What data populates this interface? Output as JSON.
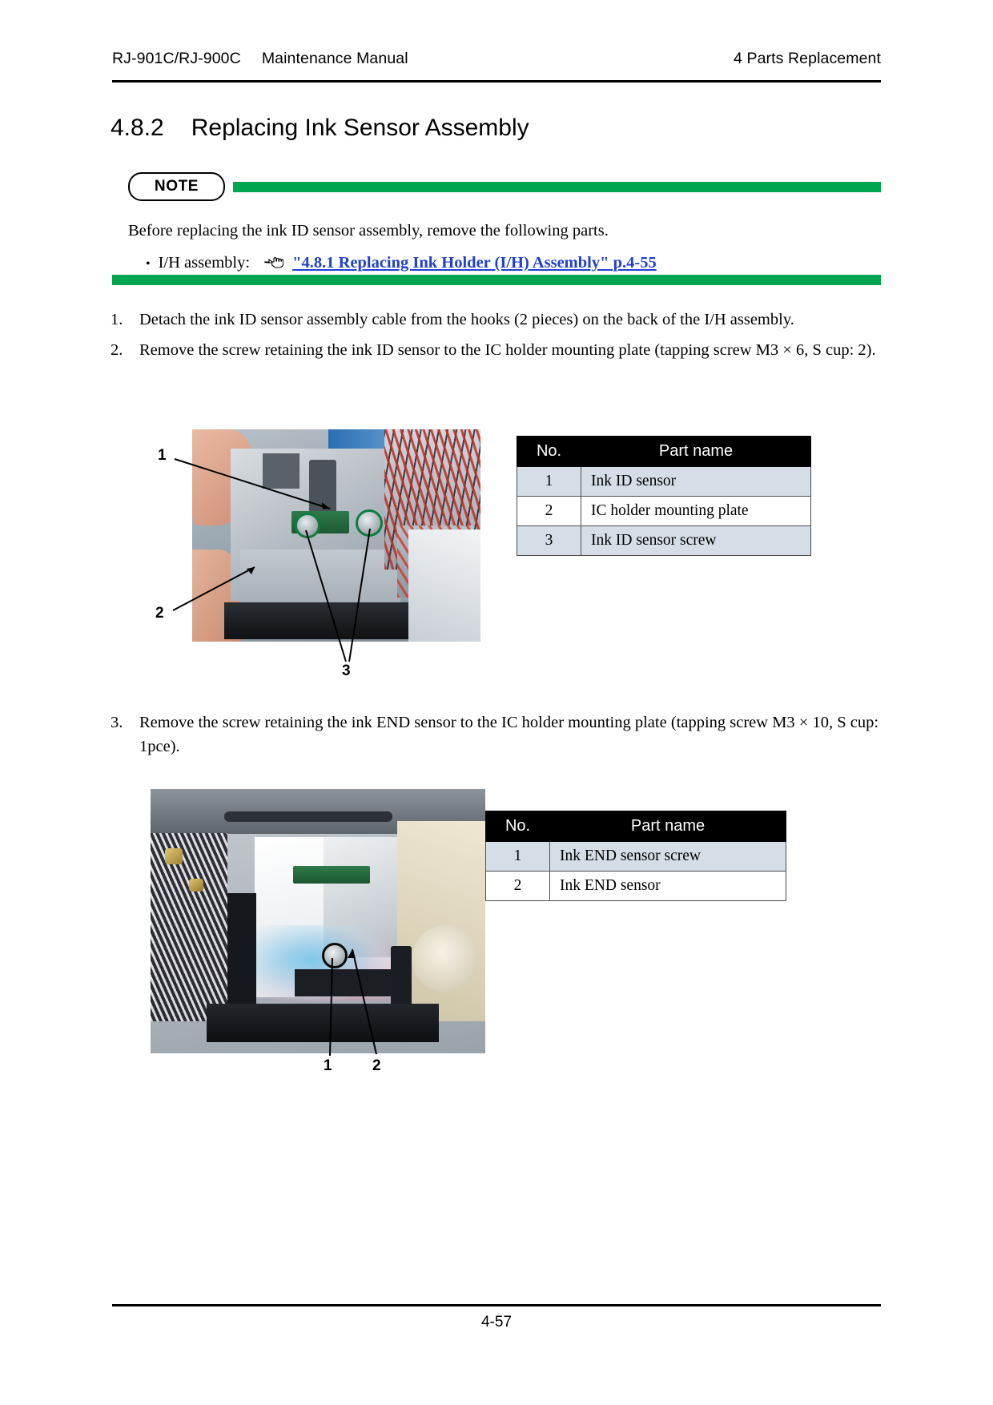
{
  "header": {
    "model": "RJ-901C/RJ-900C",
    "manual": "Maintenance Manual",
    "chapter": "4 Parts Replacement"
  },
  "section": {
    "number": "4.8.2",
    "title": "Replacing Ink Sensor Assembly"
  },
  "note": {
    "badge": "NOTE",
    "intro": "Before replacing the ink ID sensor assembly, remove the following parts.",
    "bullet_label": "I/H assembly:",
    "link_text": "\"4.8.1 Replacing Ink Holder (I/H) Assembly\" p.4-55",
    "bar_color": "#00a550",
    "link_color": "#1f3fd0"
  },
  "steps": [
    {
      "number": "1.",
      "text": "Detach the ink ID sensor assembly cable from the hooks (2 pieces) on the back of the I/H assembly."
    },
    {
      "number": "2.",
      "text": "Remove the screw retaining the ink ID sensor to the IC holder mounting plate (tapping screw M3 × 6, S cup: 2)."
    },
    {
      "number": "3.",
      "text": "Remove the screw retaining the ink END sensor to the IC holder mounting plate (tapping screw M3 × 10, S cup: 1pce)."
    }
  ],
  "figure1": {
    "callouts": [
      "1",
      "2",
      "3"
    ]
  },
  "figure2": {
    "callouts": [
      "1",
      "2"
    ]
  },
  "table1": {
    "headers": [
      "No.",
      "Part name"
    ],
    "rows": [
      {
        "no": "1",
        "part": "Ink ID sensor"
      },
      {
        "no": "2",
        "part": "IC holder mounting plate"
      },
      {
        "no": "3",
        "part": "Ink ID sensor screw"
      }
    ]
  },
  "table2": {
    "headers": [
      "No.",
      "Part name"
    ],
    "rows": [
      {
        "no": "1",
        "part": "Ink END sensor screw"
      },
      {
        "no": "2",
        "part": "Ink END sensor"
      }
    ]
  },
  "footer": {
    "page": "4-57"
  }
}
